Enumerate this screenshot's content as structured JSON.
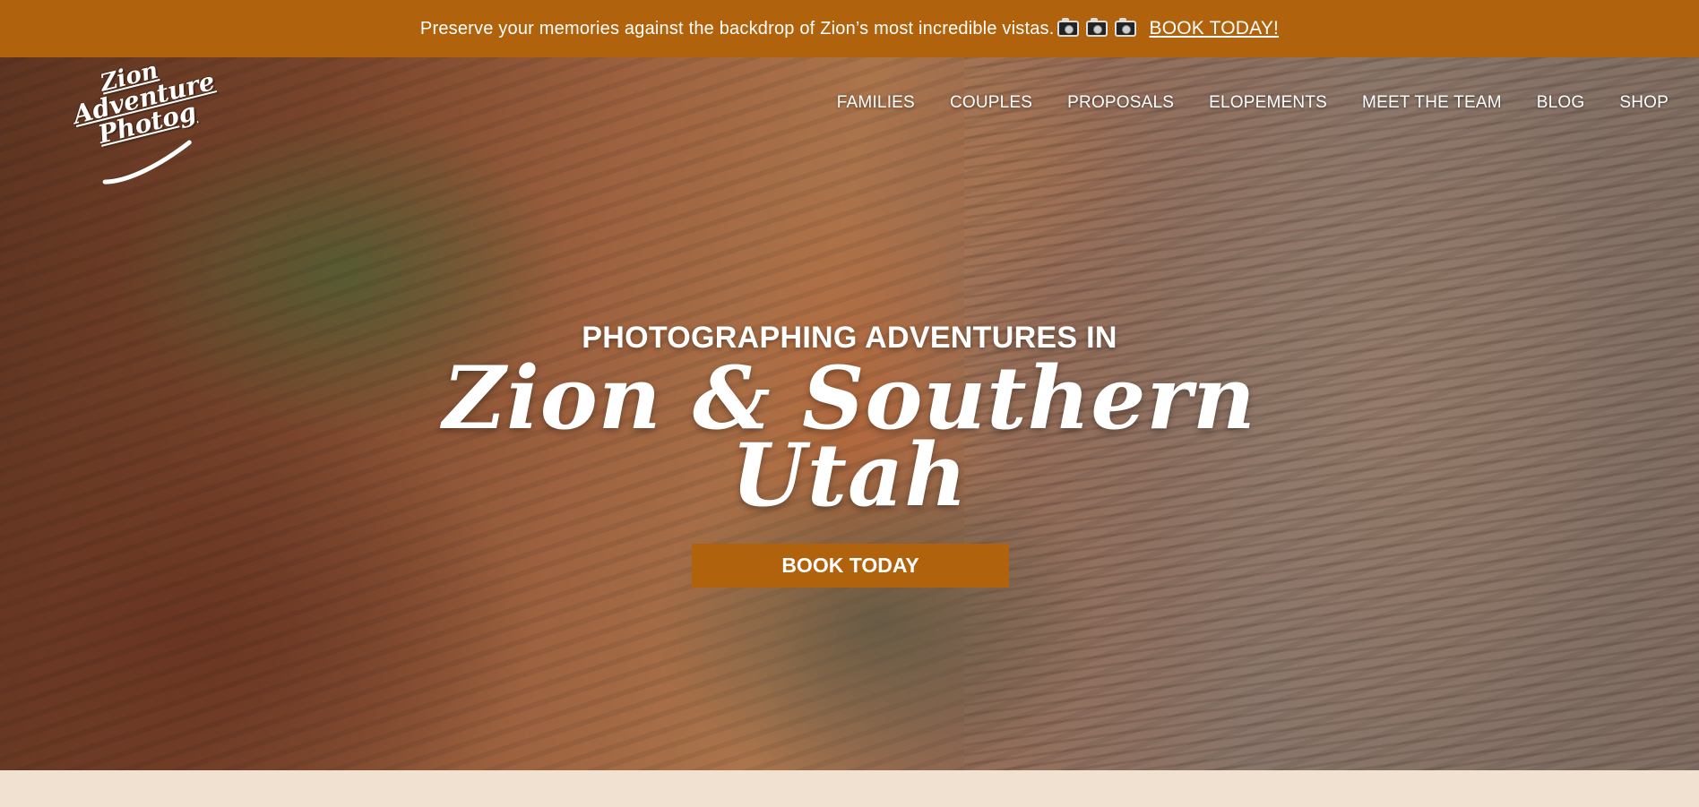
{
  "announcement": {
    "text": "Preserve your memories against the backdrop of Zion’s most incredible vistas.",
    "icons": [
      "camera-icon",
      "camera-icon",
      "camera-icon"
    ],
    "link_label": "BOOK TODAY!"
  },
  "logo": {
    "line1": "Zion",
    "line2": "Adventure",
    "line3": "Photog"
  },
  "nav": {
    "items": [
      {
        "label": "FAMILIES"
      },
      {
        "label": "COUPLES"
      },
      {
        "label": "PROPOSALS"
      },
      {
        "label": "ELOPEMENTS"
      },
      {
        "label": "MEET THE TEAM"
      },
      {
        "label": "BLOG"
      },
      {
        "label": "SHOP"
      }
    ]
  },
  "hero": {
    "kicker": "PHOTOGRAPHING ADVENTURES IN",
    "headline_line1": "Zion & Southern",
    "headline_line2": "Utah",
    "cta_label": "BOOK TODAY"
  },
  "colors": {
    "brand_orange": "#b0620c",
    "cream": "#f0e1d0",
    "text_light": "#ffffff"
  }
}
